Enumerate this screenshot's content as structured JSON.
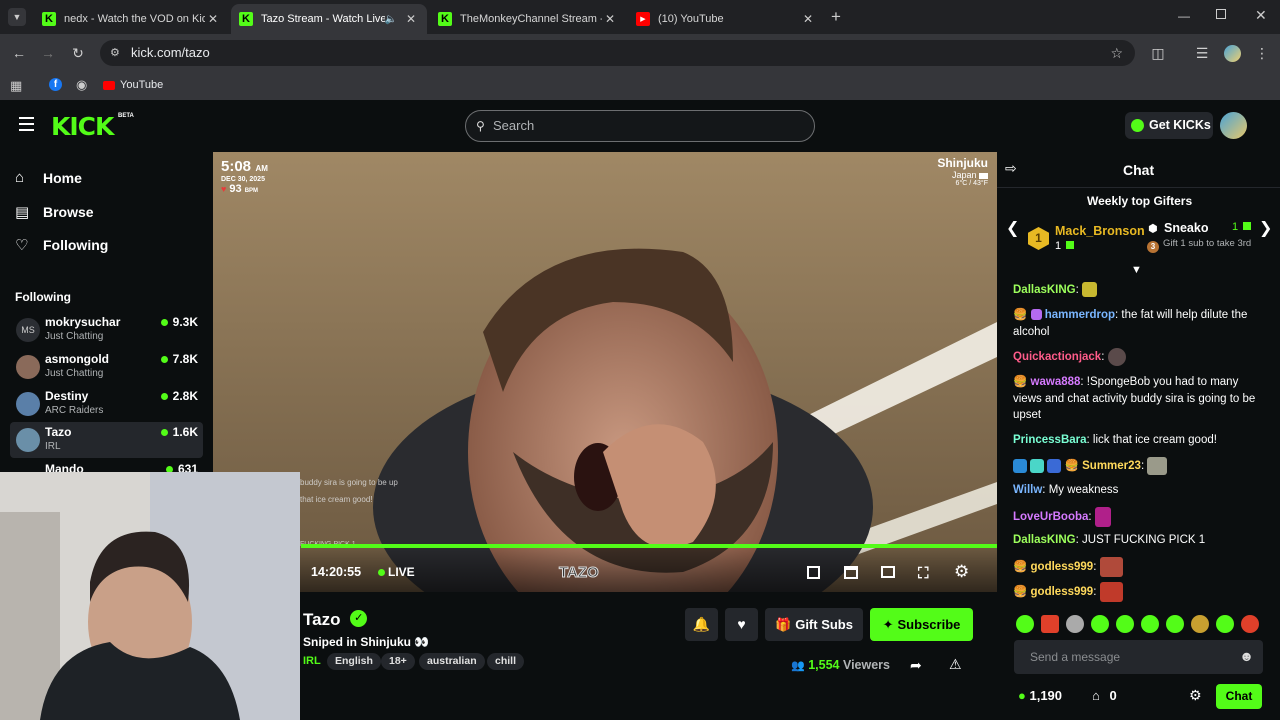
{
  "browser": {
    "tabs": [
      {
        "title": "nedx - Watch the VOD on Kick",
        "favicon": "kick-icon"
      },
      {
        "title": "Tazo Stream - Watch Live on Kick",
        "favicon": "kick-icon"
      },
      {
        "title": "TheMonkeyChannel Stream - Watch",
        "favicon": "kick-icon"
      },
      {
        "title": "(10) YouTube",
        "favicon": "youtube-icon"
      }
    ],
    "url": "kick.com/tazo",
    "bookmarks": [
      {
        "label": "YouTube"
      }
    ]
  },
  "header": {
    "logo": "KICK",
    "logo_badge": "BETA",
    "search_placeholder": "Search",
    "get_kicks": "Get KICKs"
  },
  "sidebar": {
    "nav": [
      {
        "label": "Home"
      },
      {
        "label": "Browse"
      },
      {
        "label": "Following"
      }
    ],
    "following_heading": "Following",
    "channels": [
      {
        "name": "mokrysuchar",
        "category": "Just Chatting",
        "viewers": "9.3K",
        "avatar_text": "MS"
      },
      {
        "name": "asmongold",
        "category": "Just Chatting",
        "viewers": "7.8K"
      },
      {
        "name": "Destiny",
        "category": "ARC Raiders",
        "viewers": "2.8K"
      },
      {
        "name": "Tazo",
        "category": "IRL",
        "viewers": "1.6K"
      },
      {
        "name": "Mando",
        "category": "",
        "viewers": "631"
      }
    ]
  },
  "video": {
    "overlay_time": "5:08",
    "overlay_ampm": "AM",
    "overlay_date": "DEC 30, 2025",
    "overlay_bpm": "93",
    "overlay_bpm_unit": "BPM",
    "overlay_city": "Shinjuku",
    "overlay_country": "Japan",
    "overlay_temp": "6°C / 43°F",
    "caption_1": "buddy sira is going to be up",
    "caption_2": "that ice cream good!",
    "caption_3": "FUCKING PICK 1",
    "watermark": "TAZO",
    "elapsed": "14:20:55",
    "live_label": "LIVE"
  },
  "stream": {
    "channel": "Tazo",
    "title": "Sniped in Shinjuku 👀",
    "category": "IRL",
    "tags": [
      "English",
      "18+",
      "australian",
      "chill"
    ],
    "gift_subs": "Gift Subs",
    "subscribe": "Subscribe",
    "viewers": "1,554",
    "viewers_label": "Viewers"
  },
  "chat": {
    "title": "Chat",
    "gifters_title": "Weekly top Gifters",
    "gifter1_rank": "1",
    "gifter1_name": "Mack_Bronson",
    "gifter1_count": "1",
    "gifter2_name": "Sneako",
    "gifter2_count": "1",
    "gifter3_rank": "3",
    "gifter3_text": "Gift 1 sub to take 3rd",
    "messages": [
      {
        "user": "DallasKING",
        "sep": ":",
        "text": "",
        "color": "#9dff5c"
      },
      {
        "user": "hammerdrop",
        "sep": ":",
        "text": " the fat will help dilute the alcohol",
        "color": "#7ab6ff"
      },
      {
        "user": "Quickactionjack",
        "sep": ":",
        "text": "",
        "color": "#ff5c8a"
      },
      {
        "user": "wawa888",
        "sep": ":",
        "text": " !SpongeBob you had to many views and chat activity buddy sira is going to be upset",
        "color": "#d67aff"
      },
      {
        "user": "PrincessBara",
        "sep": ":",
        "text": " lick that ice cream good!",
        "color": "#7affd4"
      },
      {
        "user": "Summer23",
        "sep": ":",
        "text": "",
        "color": "#ffd95c"
      },
      {
        "user": "Willw",
        "sep": ":",
        "text": " My weakness",
        "color": "#7ab6ff"
      },
      {
        "user": "LoveUrBooba",
        "sep": ":",
        "text": "",
        "color": "#d67aff"
      },
      {
        "user": "DallasKING",
        "sep": ":",
        "text": " JUST FUCKING PICK 1",
        "color": "#9dff5c"
      },
      {
        "user": "godless999",
        "sep": ":",
        "text": "",
        "color": "#ffd95c"
      },
      {
        "user": "godless999",
        "sep": ":",
        "text": "",
        "color": "#ffd95c"
      }
    ],
    "input_placeholder": "Send a message",
    "points": "1,190",
    "claims": "0",
    "send": "Chat"
  },
  "colors": {
    "accent": "#53fc18",
    "bg": "#0b0e0f",
    "surface": "#24272c"
  }
}
